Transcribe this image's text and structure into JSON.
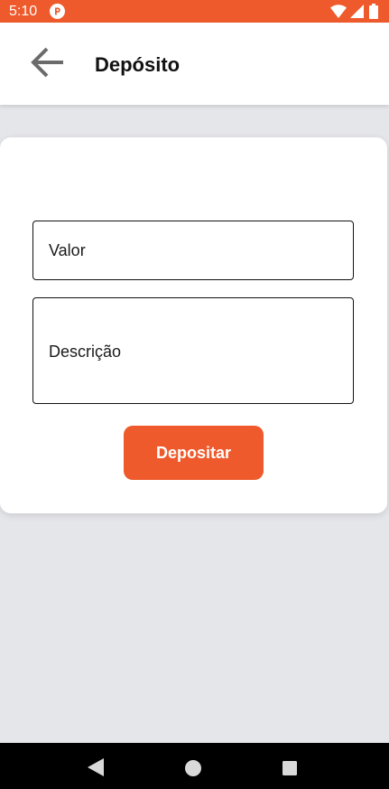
{
  "status_bar": {
    "time": "5:10",
    "background_color": "#ee5a2c",
    "icons": [
      "app-notification-icon",
      "wifi-icon",
      "signal-icon",
      "battery-icon"
    ]
  },
  "app_bar": {
    "title": "Depósito",
    "back_icon": "arrow-left-icon"
  },
  "form": {
    "valor": {
      "value": "",
      "placeholder": "Valor"
    },
    "descricao": {
      "value": "",
      "placeholder": "Descrição"
    },
    "submit_label": "Depositar"
  },
  "nav_bar": {
    "icons": [
      "nav-back-icon",
      "nav-home-icon",
      "nav-recents-icon"
    ]
  },
  "colors": {
    "accent": "#ee5a2c",
    "background": "#e5e6ea",
    "surface": "#ffffff",
    "text": "#111111"
  }
}
